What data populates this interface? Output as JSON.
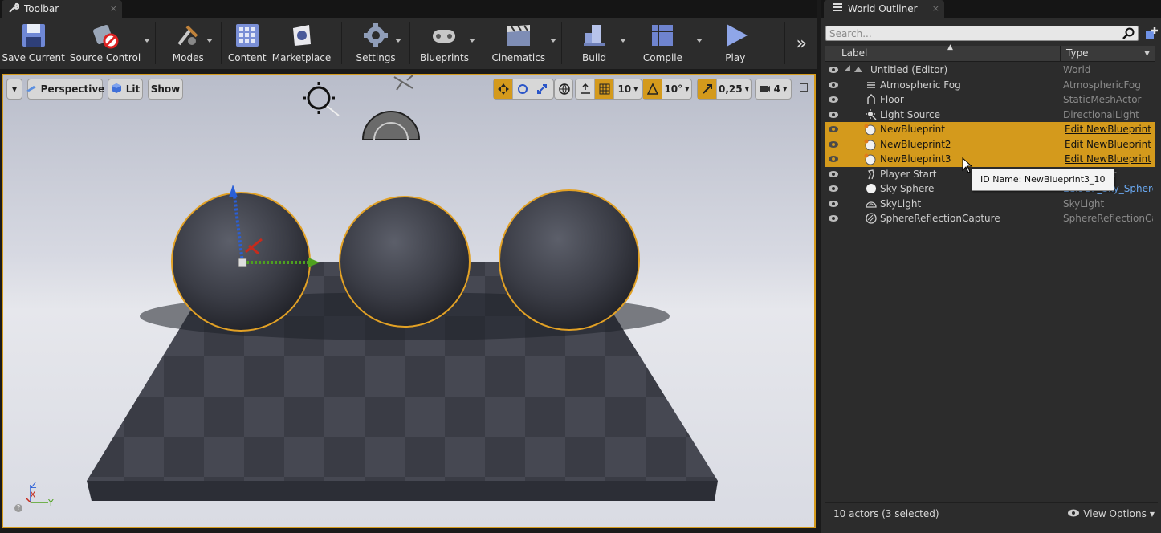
{
  "toolbar_tab": {
    "title": "Toolbar",
    "close": "×"
  },
  "toolbar": {
    "buttons": [
      {
        "label": "Save Current",
        "icon": "save-icon"
      },
      {
        "label": "Source Control",
        "icon": "source-control-icon"
      },
      {
        "label": "Modes",
        "icon": "modes-icon"
      },
      {
        "label": "Content",
        "icon": "content-icon"
      },
      {
        "label": "Marketplace",
        "icon": "marketplace-icon"
      },
      {
        "label": "Settings",
        "icon": "settings-icon"
      },
      {
        "label": "Blueprints",
        "icon": "blueprints-icon"
      },
      {
        "label": "Cinematics",
        "icon": "cinematics-icon"
      },
      {
        "label": "Build",
        "icon": "build-icon"
      },
      {
        "label": "Compile",
        "icon": "compile-icon"
      },
      {
        "label": "Play",
        "icon": "play-icon"
      }
    ],
    "overflow": "»"
  },
  "viewport": {
    "menu_arrow": "▾",
    "perspective_label": "Perspective",
    "lit_label": "Lit",
    "show_label": "Show",
    "grid_snap_value": "10",
    "rotation_snap_value": "10°",
    "scale_snap_value": "0,25",
    "camera_speed_value": "4",
    "axis": {
      "z": "Z",
      "x": "X",
      "y": "Y"
    }
  },
  "outliner_tab": {
    "title": "World Outliner",
    "close": "×"
  },
  "outliner": {
    "search_placeholder": "Search...",
    "col_label": "Label",
    "col_type": "Type",
    "rows": [
      {
        "label": "Untitled (Editor)",
        "type": "World",
        "selected": false,
        "icon": "world-icon"
      },
      {
        "label": "Atmospheric Fog",
        "type": "AtmosphericFog",
        "selected": false,
        "icon": "fog-icon"
      },
      {
        "label": "Floor",
        "type": "StaticMeshActor",
        "selected": false,
        "icon": "static-mesh-icon"
      },
      {
        "label": "Light Source",
        "type": "DirectionalLight",
        "selected": false,
        "icon": "directional-light-icon"
      },
      {
        "label": "NewBlueprint",
        "type": "Edit NewBlueprint",
        "selected": true,
        "icon": "blueprint-actor-icon"
      },
      {
        "label": "NewBlueprint2",
        "type": "Edit NewBlueprint",
        "selected": true,
        "icon": "blueprint-actor-icon"
      },
      {
        "label": "NewBlueprint3",
        "type": "Edit NewBlueprint",
        "selected": true,
        "icon": "blueprint-actor-icon"
      },
      {
        "label": "Player Start",
        "type": "PlayerStart",
        "selected": false,
        "icon": "player-start-icon"
      },
      {
        "label": "Sky Sphere",
        "type": "Edit BP_Sky_Sphere",
        "selected": false,
        "icon": "sky-sphere-icon"
      },
      {
        "label": "SkyLight",
        "type": "SkyLight",
        "selected": false,
        "icon": "skylight-icon"
      },
      {
        "label": "SphereReflectionCapture",
        "type": "SphereReflectionCapture",
        "selected": false,
        "icon": "reflection-capture-icon"
      }
    ],
    "tooltip": "ID Name: NewBlueprint3_10",
    "status": "10 actors (3 selected)",
    "view_options": "View Options"
  },
  "colors": {
    "selection": "#d49a1c",
    "panel_bg": "#2c2c2c",
    "viewport_border": "#d49a1c",
    "link": "#6aa8f0"
  }
}
